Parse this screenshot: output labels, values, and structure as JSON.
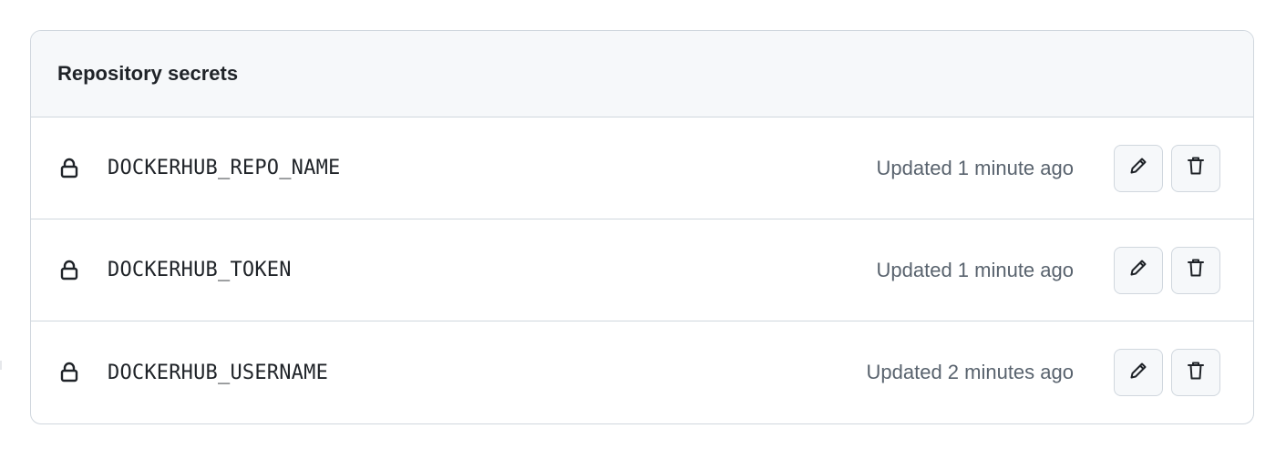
{
  "panel": {
    "title": "Repository secrets"
  },
  "secrets": [
    {
      "name": "DOCKERHUB_REPO_NAME",
      "updated": "Updated 1 minute ago"
    },
    {
      "name": "DOCKERHUB_TOKEN",
      "updated": "Updated 1 minute ago"
    },
    {
      "name": "DOCKERHUB_USERNAME",
      "updated": "Updated 2 minutes ago"
    }
  ],
  "icons": {
    "row_icon": "lock-icon",
    "edit": "pencil-icon",
    "delete": "trash-icon"
  },
  "colors": {
    "border": "#d0d7de",
    "header_bg": "#f6f8fa",
    "text_primary": "#1f2328",
    "text_muted": "#59636e"
  }
}
